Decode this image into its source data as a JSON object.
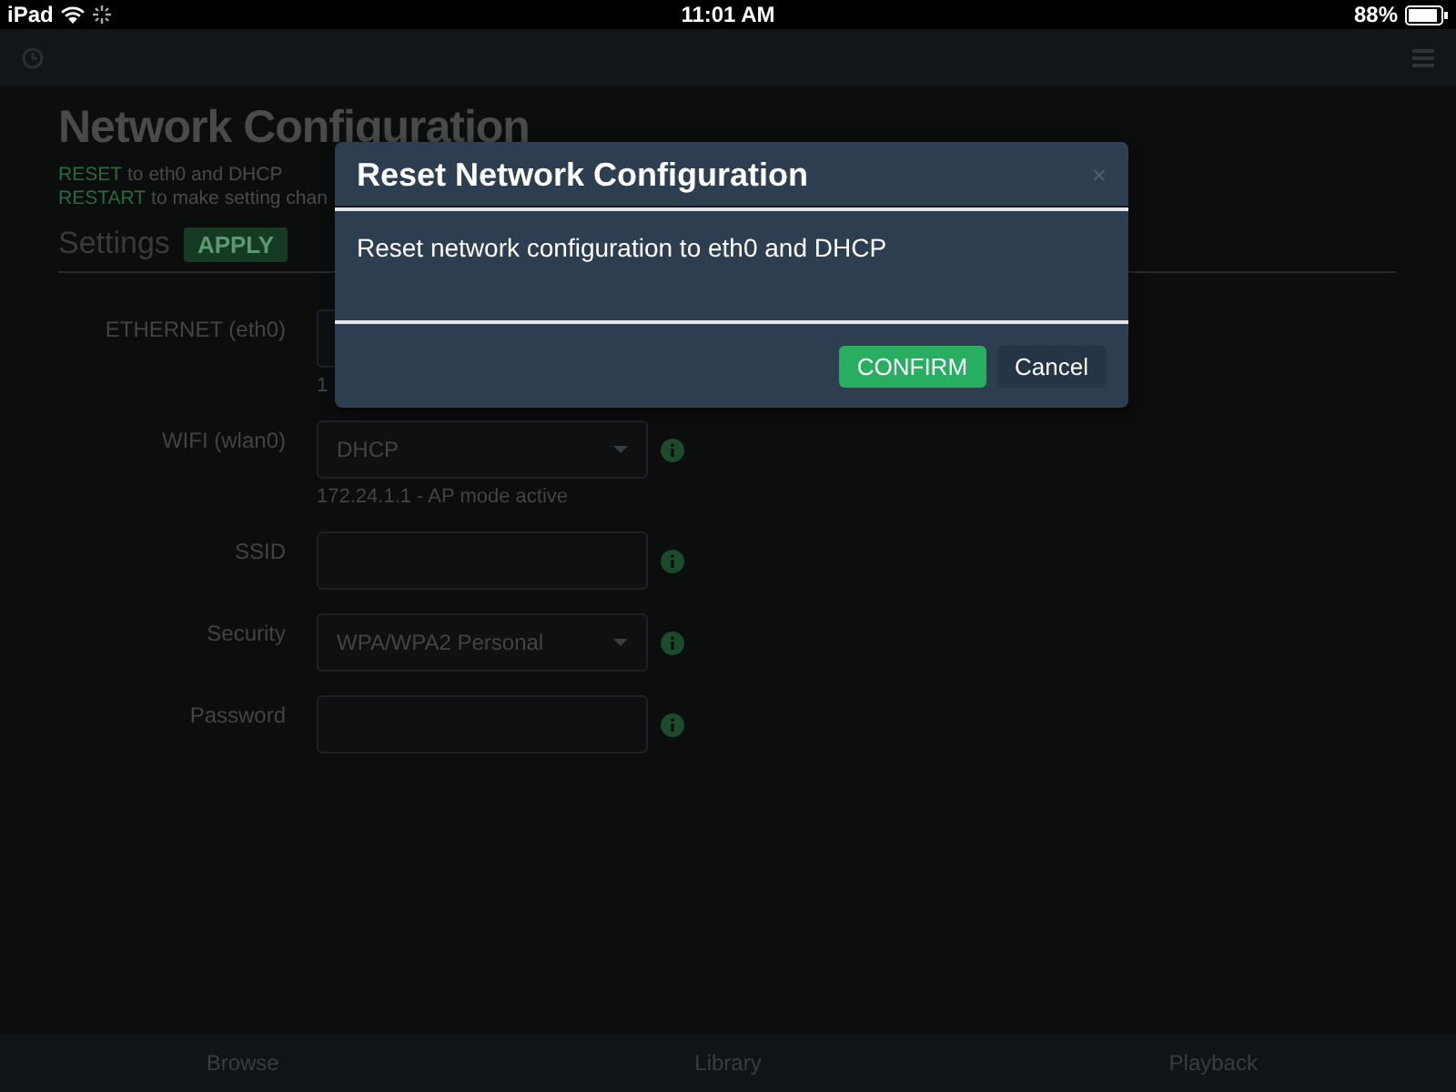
{
  "status_bar": {
    "carrier": "iPad",
    "time": "11:01 AM",
    "battery": "88%"
  },
  "page": {
    "title": "Network Configuration",
    "notes": [
      {
        "link": "RESET",
        "text": "to eth0 and DHCP"
      },
      {
        "link": "RESTART",
        "text": "to make setting chan"
      }
    ],
    "settings_heading": "Settings",
    "apply": "APPLY",
    "fields": [
      {
        "label": "ETHERNET (eth0)",
        "kind": "input",
        "hint": "1"
      },
      {
        "label": "WIFI (wlan0)",
        "kind": "select",
        "value": "DHCP",
        "hint": "172.24.1.1 - AP mode active",
        "info": true
      },
      {
        "label": "SSID",
        "kind": "input",
        "info": true
      },
      {
        "label": "Security",
        "kind": "select",
        "value": "WPA/WPA2 Personal",
        "info": true
      },
      {
        "label": "Password",
        "kind": "input",
        "info": true
      }
    ]
  },
  "modal": {
    "title": "Reset Network Configuration",
    "close": "×",
    "message": "Reset network configuration to eth0 and DHCP",
    "buttons": [
      {
        "label": "CONFIRM",
        "kind": "primary"
      },
      {
        "label": "Cancel",
        "kind": "secondary"
      }
    ]
  },
  "tabs": [
    {
      "label": "Browse"
    },
    {
      "label": "Library"
    },
    {
      "label": "Playback"
    }
  ]
}
